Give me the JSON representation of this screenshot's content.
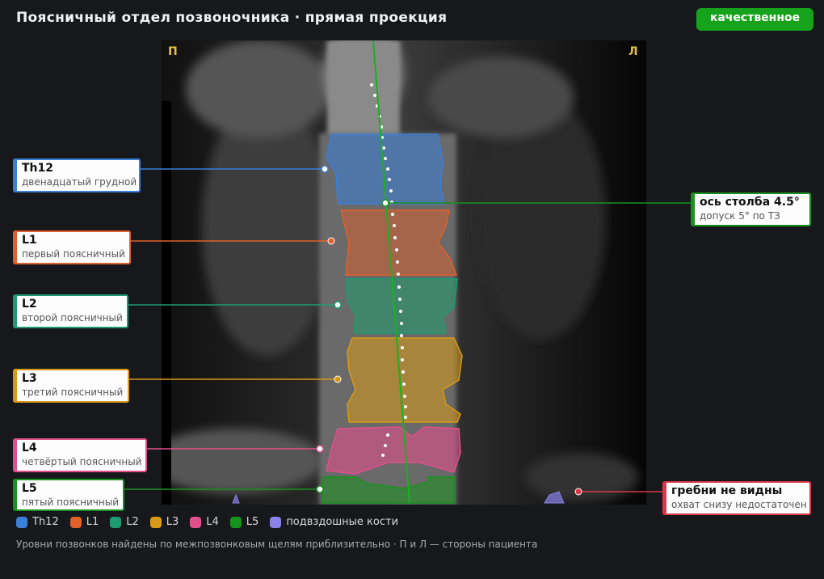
{
  "header": {
    "title": "Поясничный отдел позвоночника · прямая проекция",
    "status": "качественное",
    "status_color": "#17a21c"
  },
  "image": {
    "side_right": "П",
    "side_left": "Л"
  },
  "vertebrae": [
    {
      "id": "Th12",
      "label": "Th12",
      "desc": "двенадцатый грудной",
      "color": "#3a7fd8"
    },
    {
      "id": "L1",
      "label": "L1",
      "desc": "первый поясничный",
      "color": "#e0602c"
    },
    {
      "id": "L2",
      "label": "L2",
      "desc": "второй поясничный",
      "color": "#1f9a70"
    },
    {
      "id": "L3",
      "label": "L3",
      "desc": "третий поясничный",
      "color": "#d89a18"
    },
    {
      "id": "L4",
      "label": "L4",
      "desc": "четвёртый поясничный",
      "color": "#e0508a"
    },
    {
      "id": "L5",
      "label": "L5",
      "desc": "пятый поясничный",
      "color": "#18921e"
    }
  ],
  "axis_callout": {
    "title": "ось столба 4.5°",
    "sub": "допуск 5° по ТЗ",
    "color": "#18921e"
  },
  "warning_callout": {
    "title": "гребни не видны",
    "sub": "охват снизу недостаточен",
    "color": "#d83848"
  },
  "legend": [
    {
      "label": "Th12",
      "color": "#3a7fd8"
    },
    {
      "label": "L1",
      "color": "#e0602c"
    },
    {
      "label": "L2",
      "color": "#1f9a70"
    },
    {
      "label": "L3",
      "color": "#d89a18"
    },
    {
      "label": "L4",
      "color": "#e0508a"
    },
    {
      "label": "L5",
      "color": "#18921e"
    },
    {
      "label": "подвздошные кости",
      "color": "#8a82e8"
    }
  ],
  "footnote": "Уровни позвонков найдены по межпозвонковым щелям приблизительно · П и Л — стороны пациента"
}
